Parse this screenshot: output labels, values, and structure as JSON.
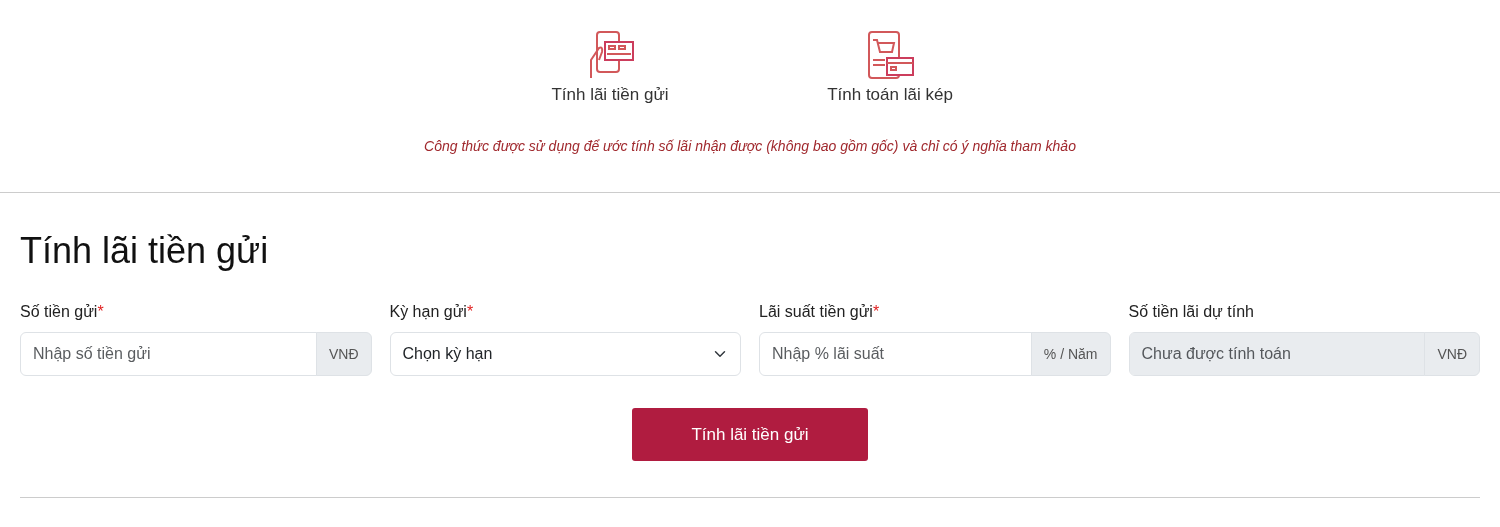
{
  "calculators": [
    {
      "kind": "deposit",
      "label": "Tính lãi tiền gửi"
    },
    {
      "kind": "compound",
      "label": "Tính toán lãi kép"
    }
  ],
  "note": "Công thức được sử dụng để ước tính số lãi nhận được (không bao gồm gốc) và chỉ có ý nghĩa tham khảo",
  "form": {
    "title": "Tính lãi tiền gửi",
    "fields": [
      {
        "kind": "input",
        "label": "Số tiền gửi",
        "required_mark": "*",
        "placeholder": "Nhập số tiền gửi",
        "addon": "VNĐ",
        "disabled": false
      },
      {
        "kind": "select",
        "label": "Kỳ hạn gửi",
        "required_mark": "*",
        "value": "Chọn kỳ hạn",
        "disabled": false
      },
      {
        "kind": "input",
        "label": "Lãi suất tiền gửi",
        "required_mark": "*",
        "placeholder": "Nhập % lãi suất",
        "addon": "% / Năm",
        "disabled": false
      },
      {
        "kind": "input",
        "label": "Số tiền lãi dự tính",
        "placeholder": "Chưa được tính toán",
        "addon": "VNĐ",
        "disabled": true
      }
    ],
    "submit": "Tính lãi tiền gửi"
  }
}
